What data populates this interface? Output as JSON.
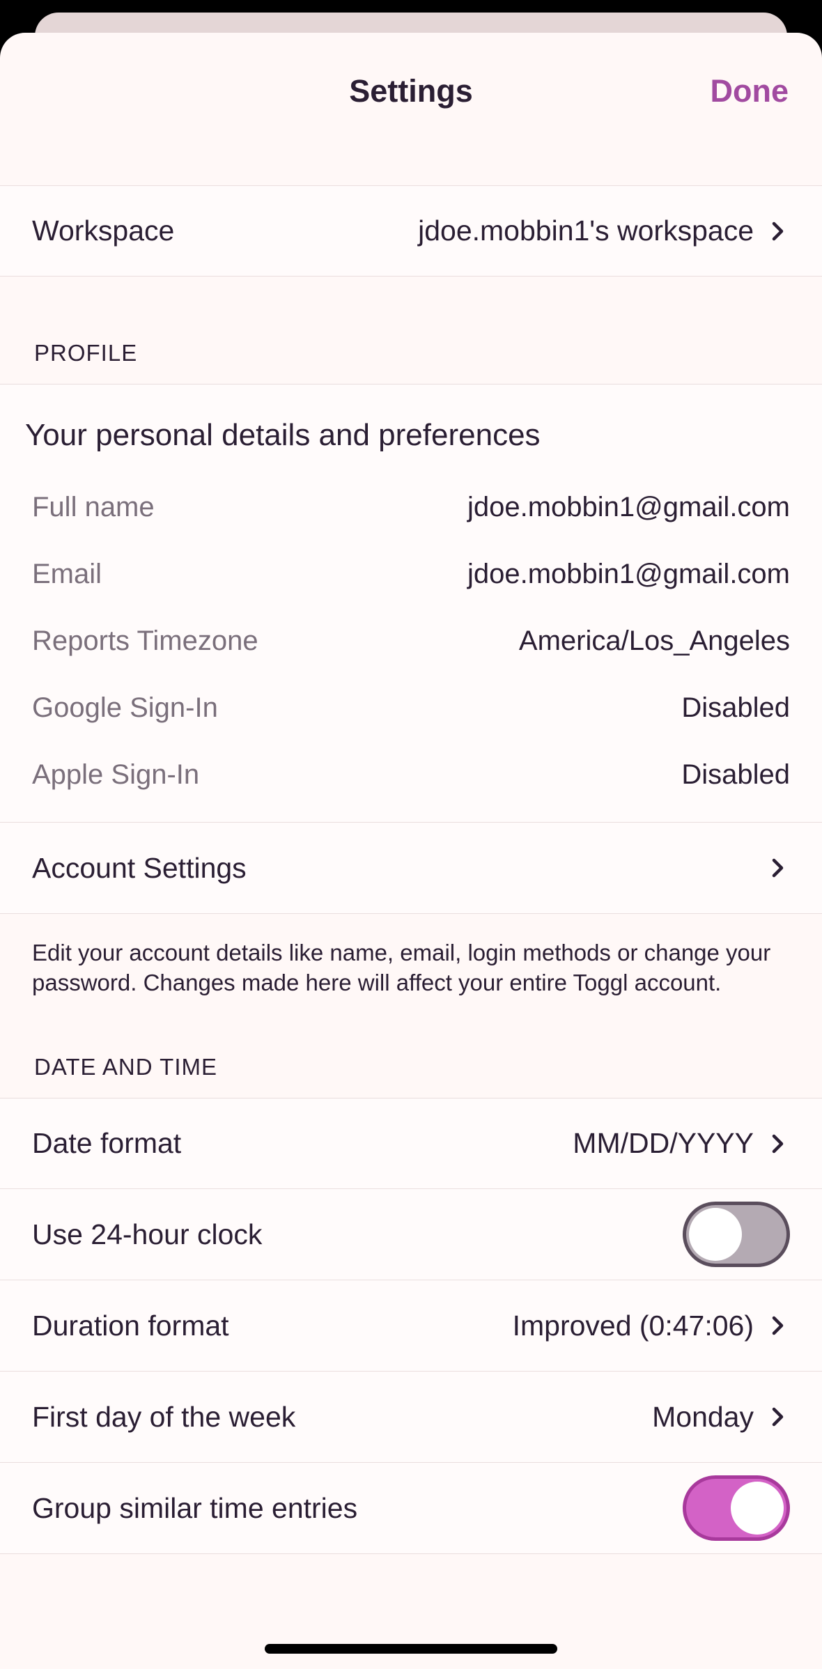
{
  "nav": {
    "title": "Settings",
    "done_label": "Done"
  },
  "workspace": {
    "label": "Workspace",
    "value": "jdoe.mobbin1's workspace"
  },
  "profile": {
    "section_title": "PROFILE",
    "heading": "Your personal details and preferences",
    "details": [
      {
        "label": "Full name",
        "value": "jdoe.mobbin1@gmail.com"
      },
      {
        "label": "Email",
        "value": "jdoe.mobbin1@gmail.com"
      },
      {
        "label": "Reports Timezone",
        "value": "America/Los_Angeles"
      },
      {
        "label": "Google Sign-In",
        "value": "Disabled"
      },
      {
        "label": "Apple Sign-In",
        "value": "Disabled"
      }
    ],
    "account_settings_label": "Account Settings",
    "account_note": "Edit your account details like name, email, login methods or change your password. Changes made here will affect your entire Toggl account."
  },
  "date_time": {
    "section_title": "DATE AND TIME",
    "date_format": {
      "label": "Date format",
      "value": "MM/DD/YYYY"
    },
    "clock_24h": {
      "label": "Use 24-hour clock",
      "enabled": false
    },
    "duration_format": {
      "label": "Duration format",
      "value": "Improved (0:47:06)"
    },
    "first_day": {
      "label": "First day of the week",
      "value": "Monday"
    },
    "group_entries": {
      "label": "Group similar time entries",
      "enabled": true
    }
  },
  "colors": {
    "accent": "#a14aa0",
    "toggle_on": "#d362c6",
    "toggle_off": "#b4aab3",
    "background": "#fff8f7"
  }
}
